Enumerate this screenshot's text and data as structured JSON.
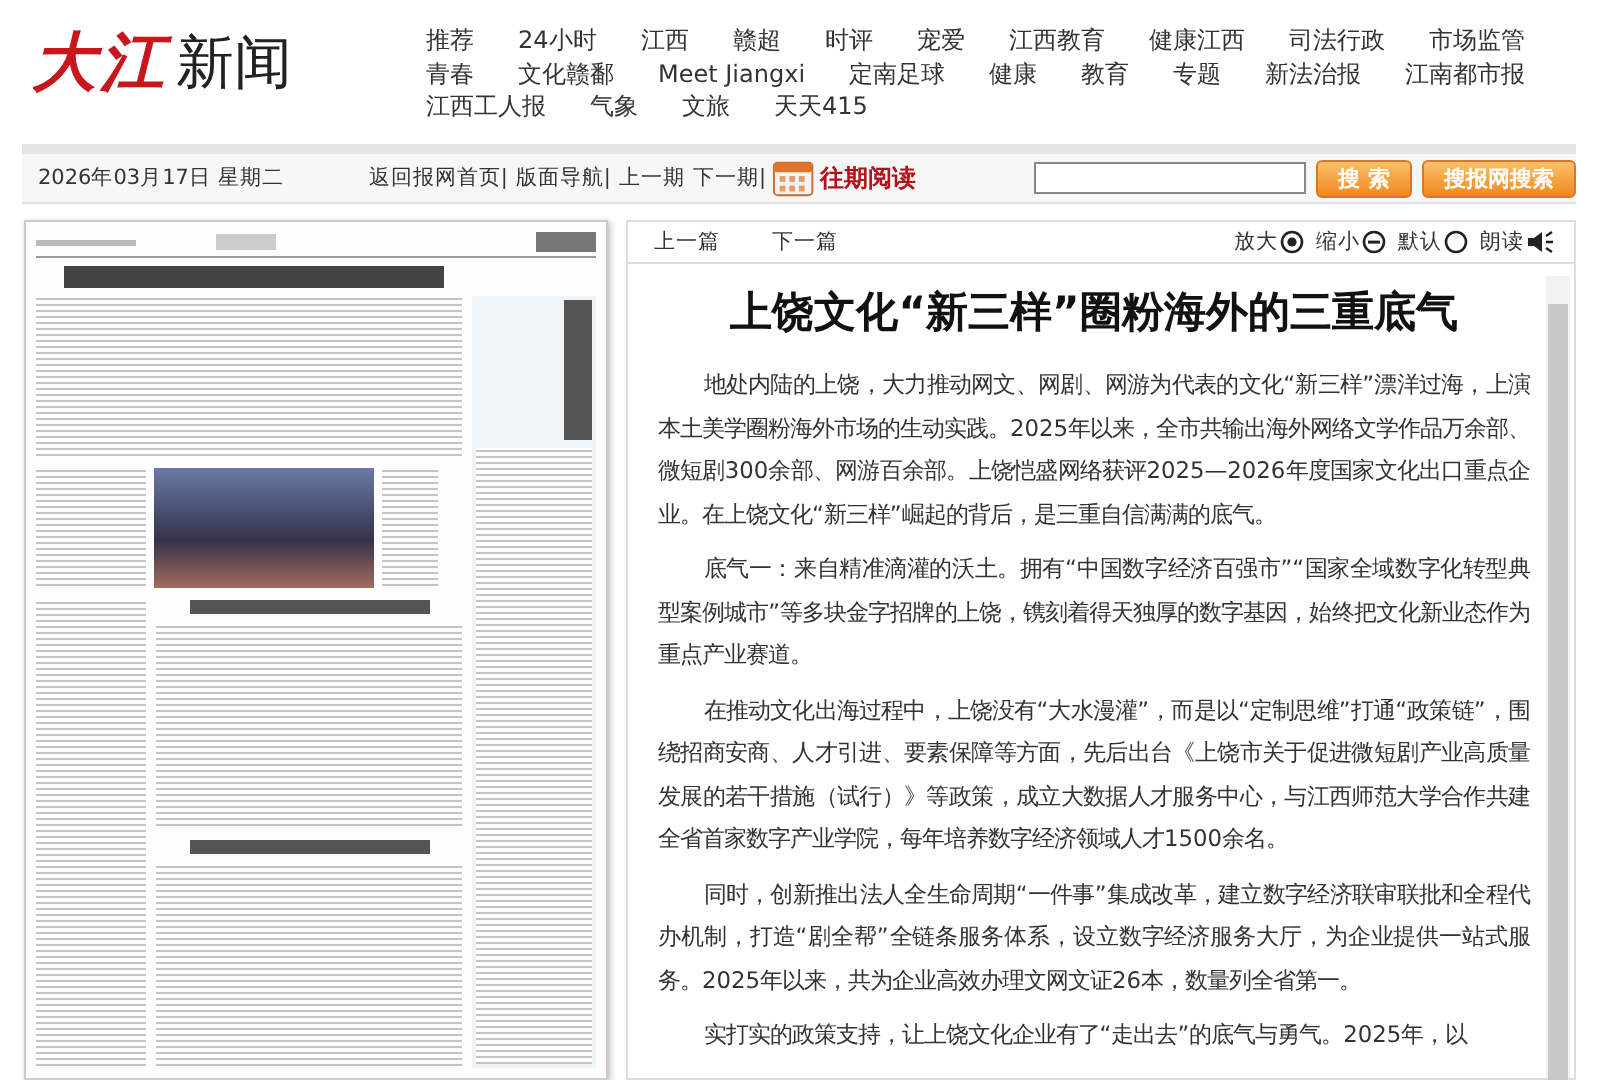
{
  "logo": {
    "red": "大江",
    "black": "新闻"
  },
  "nav": {
    "links": [
      "推荐",
      "24小时",
      "江西",
      "赣超",
      "时评",
      "宠爱",
      "江西教育",
      "健康江西",
      "司法行政",
      "市场监管",
      "青春",
      "文化赣鄱",
      "Meet Jiangxi",
      "定南足球",
      "健康",
      "教育",
      "专题",
      "新法治报",
      "江南都市报",
      "江西工人报",
      "气象",
      "文旅",
      "天天415"
    ]
  },
  "date_bar": {
    "date": "2026年03月17日 星期二",
    "links": [
      "返回报网首页|",
      "版面导航|",
      "上一期",
      "下一期|"
    ],
    "archive": "往期阅读",
    "buttons": [
      "搜 索",
      "搜报网搜索"
    ]
  },
  "article_toolbar": {
    "nav": [
      "上一篇",
      "下一篇"
    ],
    "tools": [
      {
        "label": "放大",
        "kind": "zoom-in"
      },
      {
        "label": "缩小",
        "kind": "zoom-out"
      },
      {
        "label": "默认",
        "kind": "reset"
      },
      {
        "label": "朗读",
        "kind": "read"
      }
    ]
  },
  "article": {
    "title": "上饶文化“新三样”圈粉海外的三重底气",
    "paragraphs": [
      "地处内陆的上饶，大力推动网文、网剧、网游为代表的文化“新三样”漂洋过海，上演本土美学圈粉海外市场的生动实践。2025年以来，全市共输出海外网络文学作品万余部、微短剧300余部、网游百余部。上饶恺盛网络获评2025—2026年度国家文化出口重点企业。在上饶文化“新三样”崛起的背后，是三重自信满满的底气。",
      "底气一：来自精准滴灌的沃土。拥有“中国数字经济百强市”“国家全域数字化转型典型案例城市”等多块金字招牌的上饶，镌刻着得天独厚的数字基因，始终把文化新业态作为重点产业赛道。",
      "在推动文化出海过程中，上饶没有“大水漫灌”，而是以“定制思维”打通“政策链”，围绕招商安商、人才引进、要素保障等方面，先后出台《上饶市关于促进微短剧产业高质量发展的若干措施（试行）》等政策，成立大数据人才服务中心，与江西师范大学合作共建全省首家数字产业学院，每年培养数字经济领域人才1500余名。",
      "同时，创新推出法人全生命周期“一件事”集成改革，建立数字经济联审联批和全程代办机制，打造“剧全帮”全链条服务体系，设立数字经济服务大厅，为企业提供一站式服务。2025年以来，共为企业高效办理文网文证26本，数量列全省第一。",
      "实打实的政策支持，让上饶文化企业有了“走出去”的底气与勇气。2025年，以"
    ]
  }
}
